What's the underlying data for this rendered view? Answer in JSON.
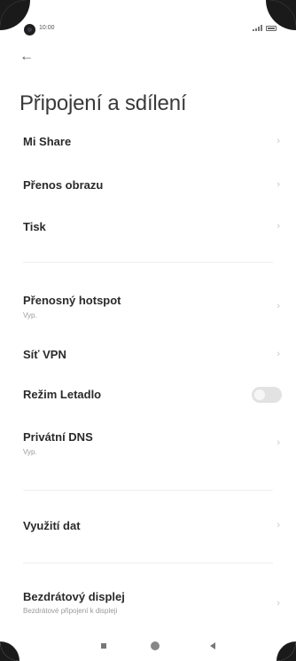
{
  "status_bar": {
    "time": "10:00"
  },
  "header": {
    "back_icon": "arrow-left-icon",
    "title": "Připojení a sdílení"
  },
  "items": [
    {
      "label": "Mi Share",
      "subtitle": "",
      "control": "chevron"
    },
    {
      "label": "Přenos obrazu",
      "subtitle": "",
      "control": "chevron"
    },
    {
      "label": "Tisk",
      "subtitle": "",
      "control": "chevron"
    },
    {
      "label": "Přenosný hotspot",
      "subtitle": "Vyp.",
      "control": "chevron"
    },
    {
      "label": "Síť VPN",
      "subtitle": "",
      "control": "chevron"
    },
    {
      "label": "Režim Letadlo",
      "subtitle": "",
      "control": "toggle",
      "toggle_on": false
    },
    {
      "label": "Privátní DNS",
      "subtitle": "Vyp.",
      "control": "chevron"
    },
    {
      "label": "Využití dat",
      "subtitle": "",
      "control": "chevron"
    },
    {
      "label": "Bezdrátový displej",
      "subtitle": "Bezdrátové připojení k displeji",
      "control": "chevron"
    }
  ],
  "nav": {
    "recents_icon": "square-icon",
    "home_icon": "circle-icon",
    "back_icon": "triangle-back-icon"
  }
}
